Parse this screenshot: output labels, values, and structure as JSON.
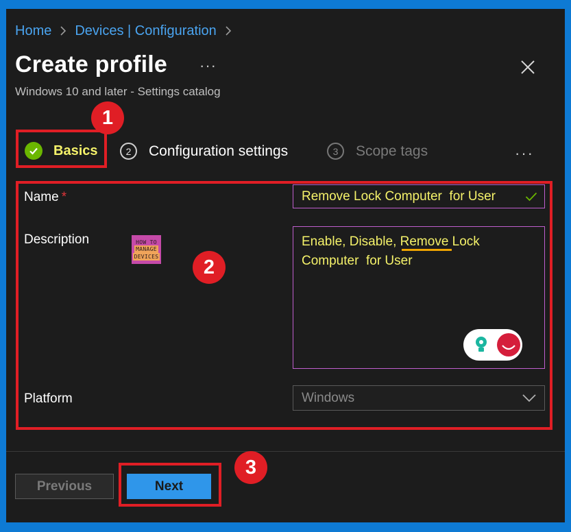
{
  "breadcrumb": {
    "items": [
      "Home",
      "Devices | Configuration"
    ]
  },
  "header": {
    "title": "Create profile",
    "more": "···",
    "subtitle": "Windows 10 and later - Settings catalog"
  },
  "tabs": [
    {
      "number": "",
      "label": "Basics",
      "state": "complete"
    },
    {
      "number": "2",
      "label": "Configuration settings",
      "state": "upcoming"
    },
    {
      "number": "3",
      "label": "Scope tags",
      "state": "disabled"
    }
  ],
  "tabs_more": "···",
  "form": {
    "name": {
      "label": "Name",
      "required_mark": "*",
      "value": "Remove Lock Computer  for User"
    },
    "description": {
      "label": "Description",
      "value": "Enable, Disable, Remove Lock Computer  for User"
    },
    "platform": {
      "label": "Platform",
      "value": "Windows"
    }
  },
  "logo": {
    "lines": [
      "HOW TO",
      "MANAGE",
      "DEVICES"
    ]
  },
  "annotations": {
    "badge1": "1",
    "badge2": "2",
    "badge3": "3"
  },
  "footer": {
    "previous_label": "Previous",
    "next_label": "Next"
  },
  "colors": {
    "accent": "#2f96ea",
    "annotation_red": "#e01e25",
    "highlight_text": "#f5f26a",
    "success": "#6bb700"
  },
  "icons": [
    "chevron-right-icon",
    "close-icon",
    "checkmark-icon",
    "chevron-down-icon",
    "lightbulb-icon"
  ]
}
